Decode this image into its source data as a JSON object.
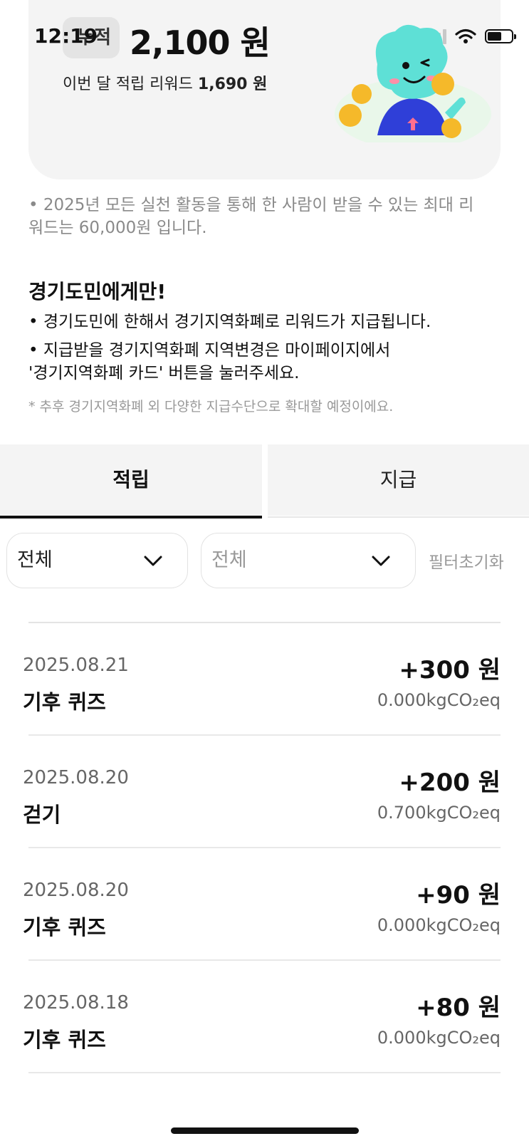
{
  "status_bar": {
    "time": "12:19"
  },
  "summary": {
    "label": "누적",
    "total": "2,100 원",
    "monthly_label": "이번 달 적립 리워드",
    "monthly_value": "1,690 원"
  },
  "notes": {
    "limit": "• 2025년 모든 실천 활동을 통해 한 사람이 받을 수 있는 최대 리워드는 60,000원 입니다.",
    "section_title": "경기도민에게만!",
    "bullet1": "• 경기도민에 한해서 경기지역화폐로 리워드가 지급됩니다.",
    "bullet2": "• 지급받을 경기지역화폐 지역변경은 마이페이지에서 '경기지역화폐 카드' 버튼을 눌러주세요.",
    "footnote": "* 추후 경기지역화폐 외 다양한 지급수단으로 확대할 예정이에요."
  },
  "tabs": {
    "earn": "적립",
    "pay": "지급"
  },
  "filters": {
    "first": "전체",
    "second": "전체",
    "reset": "필터초기화"
  },
  "records": [
    {
      "date": "2025.08.21",
      "activity": "기후 퀴즈",
      "amount": "+300 원",
      "co2": "0.000kgCO₂eq"
    },
    {
      "date": "2025.08.20",
      "activity": "걷기",
      "amount": "+200 원",
      "co2": "0.700kgCO₂eq"
    },
    {
      "date": "2025.08.20",
      "activity": "기후 퀴즈",
      "amount": "+90 원",
      "co2": "0.000kgCO₂eq"
    },
    {
      "date": "2025.08.18",
      "activity": "기후 퀴즈",
      "amount": "+80 원",
      "co2": "0.000kgCO₂eq"
    }
  ],
  "colors": {
    "accent_teal": "#5ee0d6",
    "mascot_shirt": "#2f3fd8",
    "coin": "#f5b92a"
  }
}
